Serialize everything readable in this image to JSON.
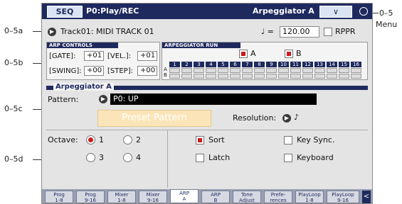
{
  "callouts": {
    "c05": "0–5",
    "c05a": "0–5a",
    "c05b": "0–5b",
    "c05c": "0–5c",
    "c05d": "0–5d",
    "menu": "Menu"
  },
  "header": {
    "mode": "SEQ",
    "page": "P0:Play/REC",
    "page_name": "Arpeggiator A",
    "menu_symbol": "∨"
  },
  "track": {
    "label": "Track01: MIDI TRACK 01",
    "tempo_symbol": "♩ =",
    "tempo_value": "120.00",
    "rppr_label": "RPPR",
    "rppr_checked": false
  },
  "arp_controls": {
    "title": "ARP CONTROLS",
    "gate_label": "[GATE]:",
    "gate_value": "+01",
    "vel_label": "[VEL.]:",
    "vel_value": "+01",
    "swing_label": "[SWING]:",
    "swing_value": "+00",
    "step_label": "[STEP]:",
    "step_value": "+00"
  },
  "arp_run": {
    "title": "ARPEGGIATOR RUN",
    "a_label": "A",
    "a_checked": true,
    "b_label": "B",
    "b_checked": true,
    "row_a": "A",
    "row_b": "B",
    "steps": [
      "1",
      "2",
      "3",
      "4",
      "5",
      "6",
      "7",
      "8",
      "9",
      "10",
      "11",
      "12",
      "13",
      "14",
      "15",
      "16"
    ]
  },
  "arpeggiator": {
    "section_title": "Arpeggiator A",
    "pattern_label": "Pattern:",
    "pattern_value": "P0: UP",
    "preset_button": "Preset Pattern",
    "resolution_label": "Resolution:",
    "resolution_value": "♪",
    "octave_label": "Octave:",
    "octave_options": [
      "1",
      "2",
      "3",
      "4"
    ],
    "octave_selected": "1",
    "sort_label": "Sort",
    "sort_checked": true,
    "latch_label": "Latch",
    "latch_checked": false,
    "keysync_label": "Key Sync.",
    "keysync_checked": false,
    "keyboard_label": "Keyboard",
    "keyboard_checked": false
  },
  "bottom_tabs": [
    {
      "line1": "Prog",
      "line2": "1-8"
    },
    {
      "line1": "Prog",
      "line2": "9-16"
    },
    {
      "line1": "Mixer",
      "line2": "1-8"
    },
    {
      "line1": "Mixer",
      "line2": "9-16"
    },
    {
      "line1": "ARP",
      "line2": "A"
    },
    {
      "line1": "ARP",
      "line2": "B"
    },
    {
      "line1": "Tone",
      "line2": "Adjust"
    },
    {
      "line1": "Prefe-",
      "line2": "rences"
    },
    {
      "line1": "PlayLoop",
      "line2": "1-8"
    },
    {
      "line1": "PlayLoop",
      "line2": "9-16"
    }
  ],
  "active_tab": "ARP A",
  "colors": {
    "header": "#1e2a5e",
    "accent_red": "#cc1a1a",
    "preset_bg": "#fbe5b8"
  }
}
